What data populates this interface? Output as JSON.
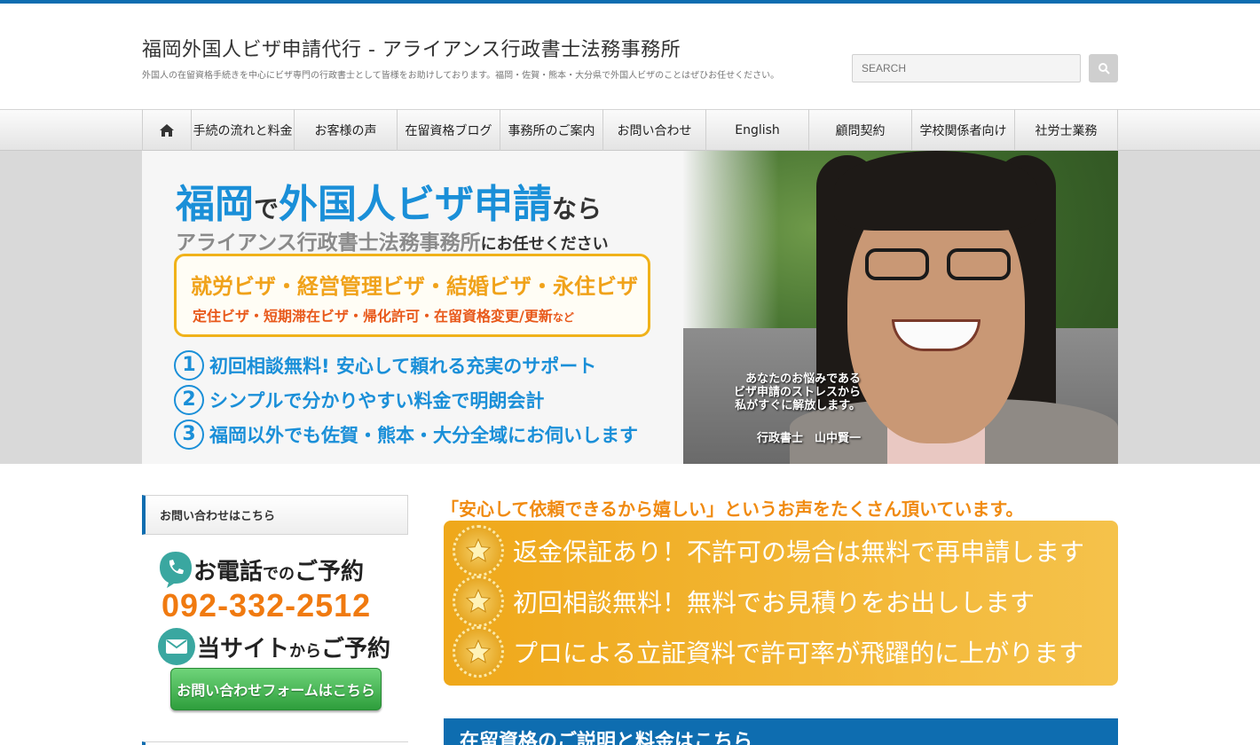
{
  "site": {
    "title": "福岡外国人ビザ申請代行 - アライアンス行政書士法務事務所",
    "description": "外国人の在留資格手続きを中心にビザ専門の行政書士として皆様をお助けしております。福岡・佐賀・熊本・大分県で外国人ビザのことはぜひお任せください。"
  },
  "search": {
    "placeholder": "SEARCH",
    "icon": "search-icon"
  },
  "nav": {
    "home_icon": "home-icon",
    "items": [
      "手続の流れと料金",
      "お客様の声",
      "在留資格ブログ",
      "事務所のご案内",
      "お問い合わせ",
      "English",
      "顧問契約",
      "学校関係者向け",
      "社労士業務"
    ]
  },
  "hero": {
    "line1_a": "福岡",
    "line1_b": "で",
    "line1_c": "外国人ビザ申請",
    "line1_d": "なら",
    "line2_a": "アライアンス行政書士法務事務所",
    "line2_b": "にお任せください",
    "visa_line1": "就労ビザ・経営管理ビザ・結婚ビザ・永住ビザ",
    "visa_line2": "定住ビザ・短期滞在ビザ・帰化許可・在留資格変更/更新",
    "visa_line2_suffix": "など",
    "points": [
      {
        "num": "1",
        "text": "初回相談無料! 安心して頼れる充実のサポート"
      },
      {
        "num": "2",
        "text": "シンプルで分かりやすい料金で明朗会計"
      },
      {
        "num": "3",
        "text": "福岡以外でも佐賀・熊本・大分全域にお伺いします"
      }
    ],
    "quote_l1": "あなたのお悩みである",
    "quote_l2": "ビザ申請のストレスから",
    "quote_l3": "私がすぐに解放します。",
    "signature": "行政書士　山中賢一"
  },
  "sidebar": {
    "heading": "お問い合わせはこちら",
    "tel_title_a": "お電話",
    "tel_title_b": "での",
    "tel_title_c": "ご予約",
    "tel_number": "092-332-2512",
    "mail_title_a": "当サイト",
    "mail_title_b": "から",
    "mail_title_c": "ご予約",
    "contact_button": "お問い合わせフォームはこちら"
  },
  "main": {
    "praise": "「安心して依頼できるから嬉しい」というお声をたくさん頂いています。",
    "guarantees": [
      "返金保証あり！不許可の場合は無料で再申請します",
      "初回相談無料！無料でお見積りをお出しします",
      "プロによる立証資料で許可率が飛躍的に上がります"
    ],
    "section_title": "在留資格のご説明と料金はこちら"
  },
  "colors": {
    "brand_blue": "#0e6db0",
    "hero_blue": "#1a8fd8",
    "accent_orange": "#f08a10",
    "gold": "#efa81a",
    "button_green": "#2e9e3c"
  }
}
